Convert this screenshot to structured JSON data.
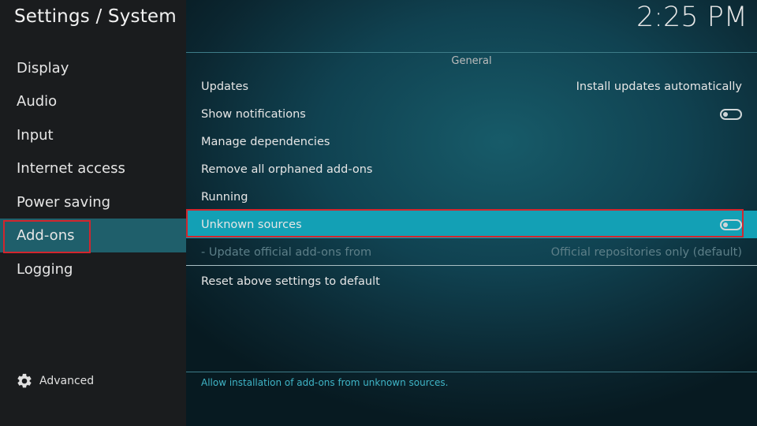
{
  "header": {
    "title": "Settings / System",
    "time": "2:25 PM"
  },
  "sidebar": {
    "items": [
      {
        "label": "Display"
      },
      {
        "label": "Audio"
      },
      {
        "label": "Input"
      },
      {
        "label": "Internet access"
      },
      {
        "label": "Power saving"
      },
      {
        "label": "Add-ons",
        "active": true
      },
      {
        "label": "Logging"
      }
    ],
    "advanced_label": "Advanced"
  },
  "main": {
    "group_title": "General",
    "settings": [
      {
        "label": "Updates",
        "value": "Install updates automatically"
      },
      {
        "label": "Show notifications",
        "toggle": false
      },
      {
        "label": "Manage dependencies"
      },
      {
        "label": "Remove all orphaned add-ons"
      },
      {
        "label": "Running"
      },
      {
        "label": "Unknown sources",
        "toggle": false,
        "focused": true
      },
      {
        "label": "- Update official add-ons from",
        "value": "Official repositories only (default)",
        "disabled": true
      }
    ],
    "reset_label": "Reset above settings to default",
    "description": "Allow installation of add-ons from unknown sources."
  },
  "colors": {
    "accent": "#13a0b5",
    "highlight_border": "#d2262e",
    "sidebar_active": "#1f5f6b"
  },
  "icons": {
    "advanced": "gear-icon"
  }
}
